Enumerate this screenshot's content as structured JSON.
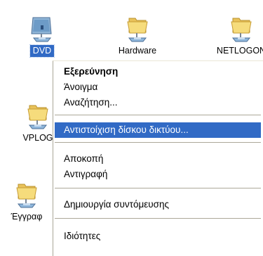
{
  "desktop": {
    "icons": [
      {
        "label": "DVD",
        "selected": true,
        "icon": "shared-folder-icon"
      },
      {
        "label": "Hardware",
        "selected": false,
        "icon": "shared-folder-icon"
      },
      {
        "label": "NETLOGON",
        "selected": false,
        "icon": "shared-folder-icon"
      },
      {
        "label": "VPLOG",
        "selected": false,
        "icon": "shared-folder-icon"
      },
      {
        "label": "Έγγραφ",
        "selected": false,
        "icon": "shared-folder-icon"
      }
    ]
  },
  "context_menu": {
    "items": [
      {
        "label": "Εξερεύνηση",
        "bold": true
      },
      {
        "label": "Άνοιγμα"
      },
      {
        "label": "Αναζήτηση..."
      },
      {
        "label": "Αντιστοίχιση δίσκου δικτύου...",
        "highlighted": true
      },
      {
        "label": "Αποκοπή"
      },
      {
        "label": "Αντιγραφή"
      },
      {
        "label": "Δημιουργία συντόμευσης"
      },
      {
        "label": "Ιδιότητες"
      }
    ]
  },
  "colors": {
    "selection": "#316ac5",
    "folder": "#f2d36a",
    "separator": "#aca899"
  }
}
